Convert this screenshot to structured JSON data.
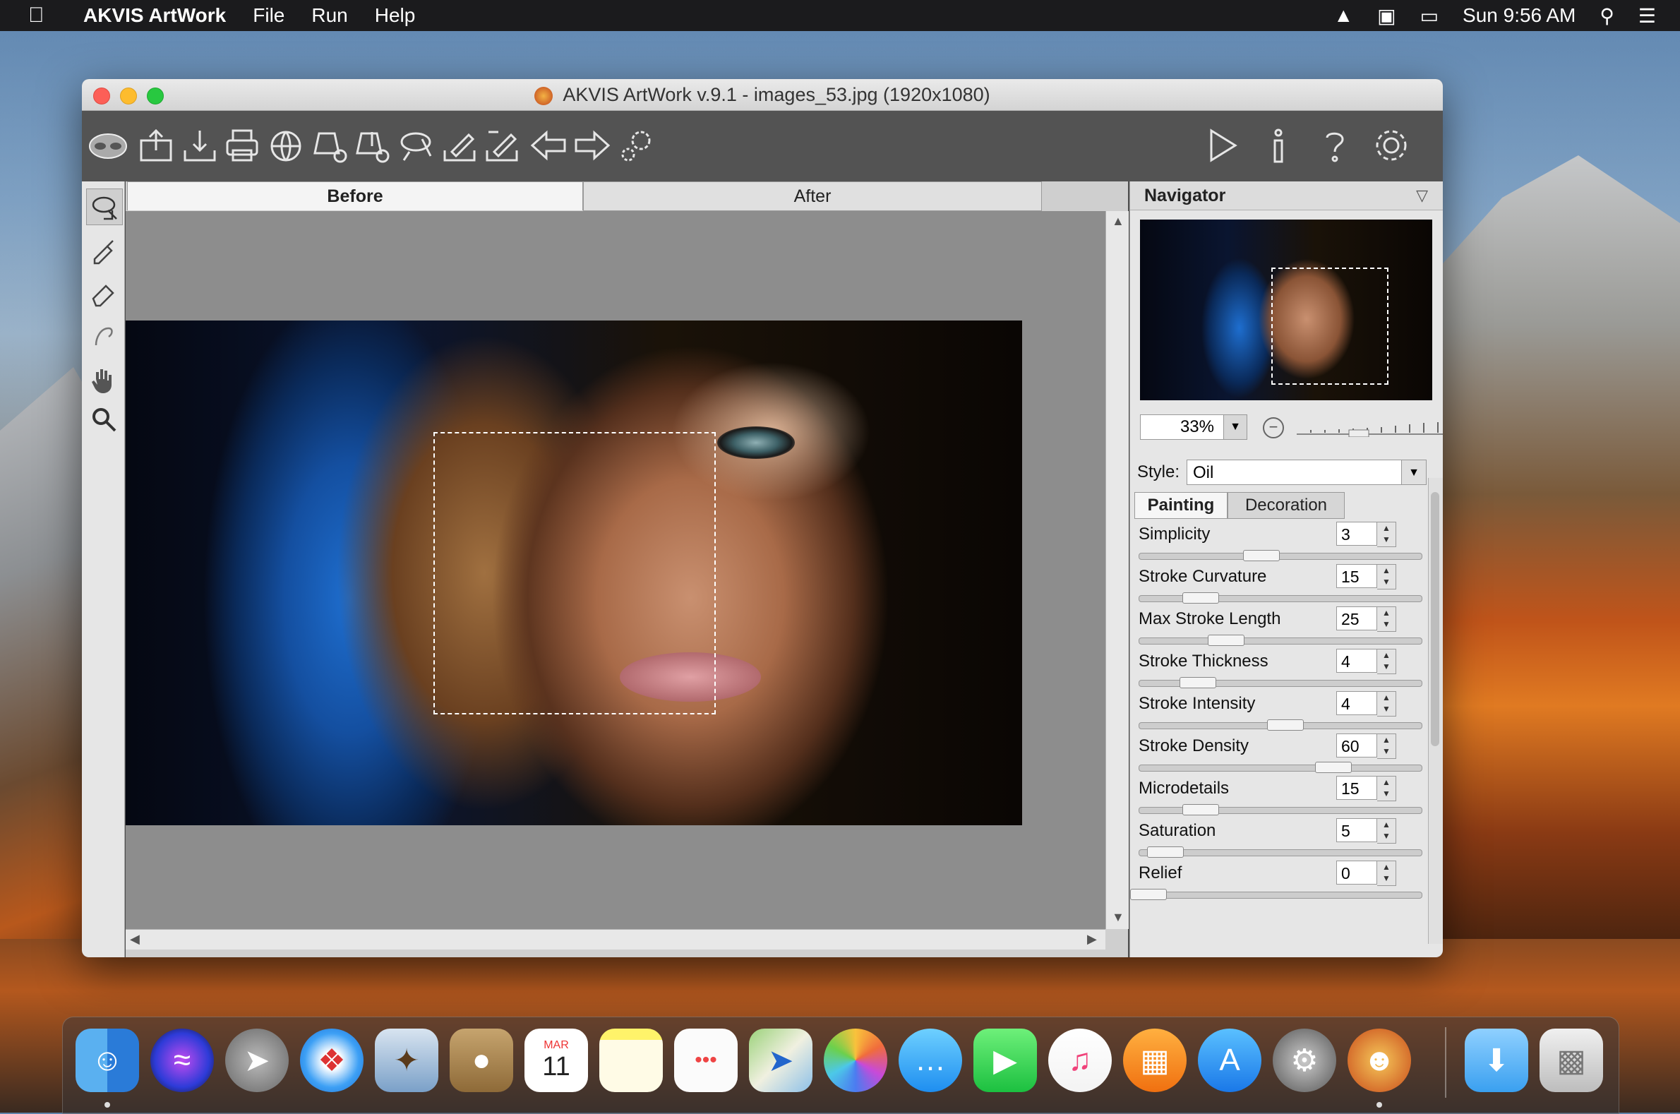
{
  "menubar": {
    "app_name": "AKVIS ArtWork",
    "menus": [
      "File",
      "Run",
      "Help"
    ],
    "clock": "Sun 9:56 AM"
  },
  "window": {
    "title": "AKVIS ArtWork v.9.1 - images_53.jpg (1920x1080)"
  },
  "toolbar": {
    "left_icons": [
      "logo-icon",
      "open-icon",
      "save-icon",
      "print-icon",
      "share-icon",
      "import-strokes-icon",
      "export-strokes-icon",
      "batch-icon",
      "load-preset-icon",
      "save-preset-icon",
      "undo-icon",
      "redo-icon",
      "plugins-icon"
    ],
    "right_icons": [
      "run-icon",
      "info-icon",
      "help-icon",
      "preferences-icon"
    ]
  },
  "canvas": {
    "tabs": [
      "Before",
      "After"
    ],
    "active_tab": "Before"
  },
  "navigator": {
    "title": "Navigator",
    "zoom": "33%"
  },
  "settings": {
    "style_label": "Style:",
    "style_value": "Oil",
    "tabs": [
      "Painting",
      "Decoration"
    ],
    "params": [
      {
        "label": "Simplicity",
        "value": "3"
      },
      {
        "label": "Stroke Curvature",
        "value": "15"
      },
      {
        "label": "Max Stroke Length",
        "value": "25"
      },
      {
        "label": "Stroke Thickness",
        "value": "4"
      },
      {
        "label": "Stroke Intensity",
        "value": "4"
      },
      {
        "label": "Stroke Density",
        "value": "60"
      },
      {
        "label": "Microdetails",
        "value": "15"
      },
      {
        "label": "Saturation",
        "value": "5"
      },
      {
        "label": "Relief",
        "value": "0"
      }
    ]
  },
  "dock": {
    "calendar_month": "MAR",
    "calendar_day": "11",
    "apps": [
      "finder",
      "siri",
      "launchpad",
      "safari",
      "mail",
      "contacts",
      "calendar",
      "notes",
      "reminders",
      "maps",
      "photos",
      "messages",
      "facetime",
      "itunes",
      "ibooks",
      "app-store",
      "system-preferences",
      "akvis-artwork",
      "downloads",
      "trash"
    ]
  },
  "colors": {
    "toolbar_bg": "#535353",
    "panel_bg": "#e6e6e6",
    "menubar_bg": "#1b1b1d"
  }
}
